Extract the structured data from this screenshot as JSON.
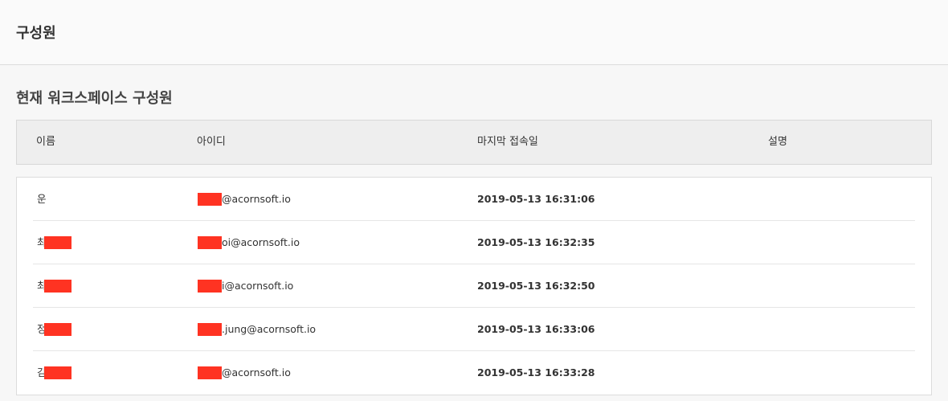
{
  "header": {
    "title": "구성원"
  },
  "section": {
    "title": "현재 워크스페이스 구성원"
  },
  "table": {
    "columns": [
      "이름",
      "아이디",
      "마지막 접속일",
      "설명"
    ],
    "rows": [
      {
        "name_visible": "운",
        "name_redacted": false,
        "id_visible": "@acornsoft.io",
        "last_access": "2019-05-13 16:31:06",
        "description": ""
      },
      {
        "name_visible": "최",
        "name_redacted": true,
        "id_visible": "oi@acornsoft.io",
        "last_access": "2019-05-13 16:32:35",
        "description": ""
      },
      {
        "name_visible": "최",
        "name_redacted": true,
        "id_visible": "i@acornsoft.io",
        "last_access": "2019-05-13 16:32:50",
        "description": ""
      },
      {
        "name_visible": "정",
        "name_redacted": true,
        "id_visible": ".jung@acornsoft.io",
        "last_access": "2019-05-13 16:33:06",
        "description": ""
      },
      {
        "name_visible": "김",
        "name_redacted": true,
        "id_visible": "@acornsoft.io",
        "last_access": "2019-05-13 16:33:28",
        "description": ""
      }
    ]
  },
  "colors": {
    "redaction": "#ff3322",
    "header_bg": "#eeeeee",
    "page_bg": "#f7f7f7"
  }
}
